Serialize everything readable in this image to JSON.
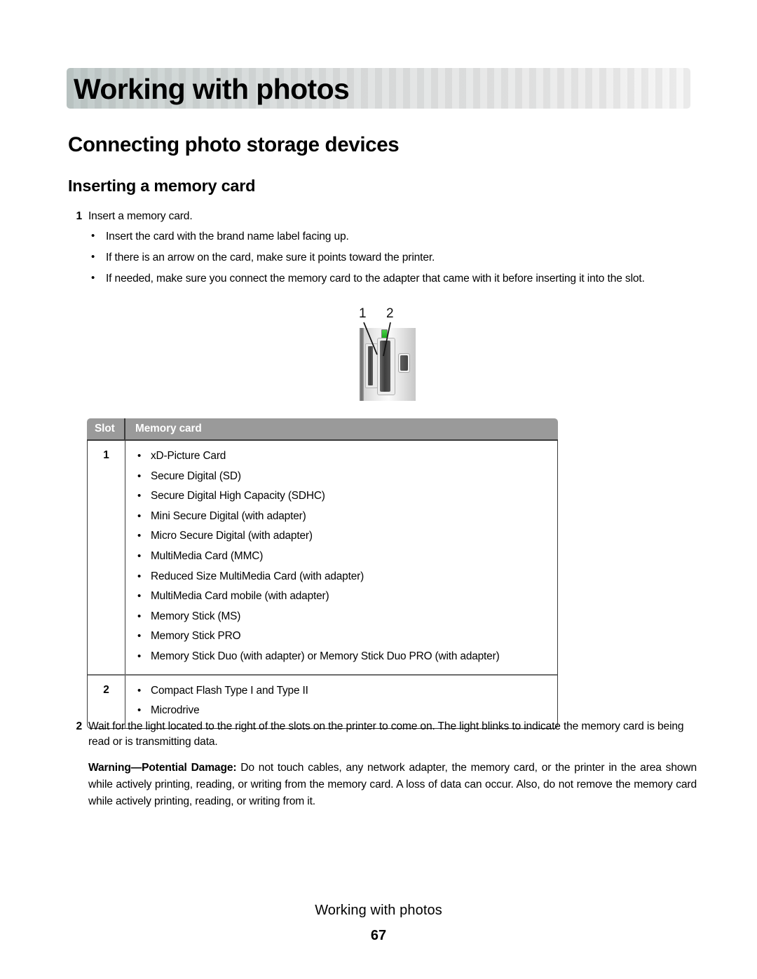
{
  "chapter": {
    "banner_title": "Working with photos",
    "banner_accent_color": "#c1cbca"
  },
  "headings": {
    "section": "Connecting photo storage devices",
    "subsection": "Inserting a memory card"
  },
  "steps": [
    {
      "number": "1",
      "text": "Insert a memory card.",
      "bullets": [
        "Insert the card with the brand name label facing up.",
        "If there is an arrow on the card, make sure it points toward the printer.",
        "If needed, make sure you connect the memory card to the adapter that came with it before inserting it into the slot."
      ]
    },
    {
      "number": "2",
      "text": "Wait for the light located to the right of the slots on the printer to come on. The light blinks to indicate the memory card is being read or is transmitting data."
    }
  ],
  "illustration": {
    "label_1": "1",
    "label_2": "2",
    "led_color": "#2ab52a"
  },
  "table": {
    "headers": {
      "slot": "Slot",
      "memory_card": "Memory card"
    },
    "header_bg": "#9a9a9a",
    "rows": [
      {
        "slot": "1",
        "cards": [
          "xD-Picture Card",
          "Secure Digital (SD)",
          "Secure Digital High Capacity (SDHC)",
          "Mini Secure Digital (with adapter)",
          "Micro Secure Digital (with adapter)",
          "MultiMedia Card (MMC)",
          "Reduced Size MultiMedia Card (with adapter)",
          "MultiMedia Card mobile (with adapter)",
          "Memory Stick (MS)",
          "Memory Stick PRO",
          "Memory Stick Duo (with adapter) or Memory Stick Duo PRO (with adapter)"
        ]
      },
      {
        "slot": "2",
        "cards": [
          "Compact Flash Type I and Type II",
          "Microdrive"
        ]
      }
    ]
  },
  "warning": {
    "lead": "Warning—Potential Damage:",
    "body": " Do not touch cables, any network adapter, the memory card, or the printer in the area shown while actively printing, reading, or writing from the memory card. A loss of data can occur. Also, do not remove the memory card while actively printing, reading, or writing from it."
  },
  "footer": {
    "title": "Working with photos",
    "page_number": "67"
  }
}
